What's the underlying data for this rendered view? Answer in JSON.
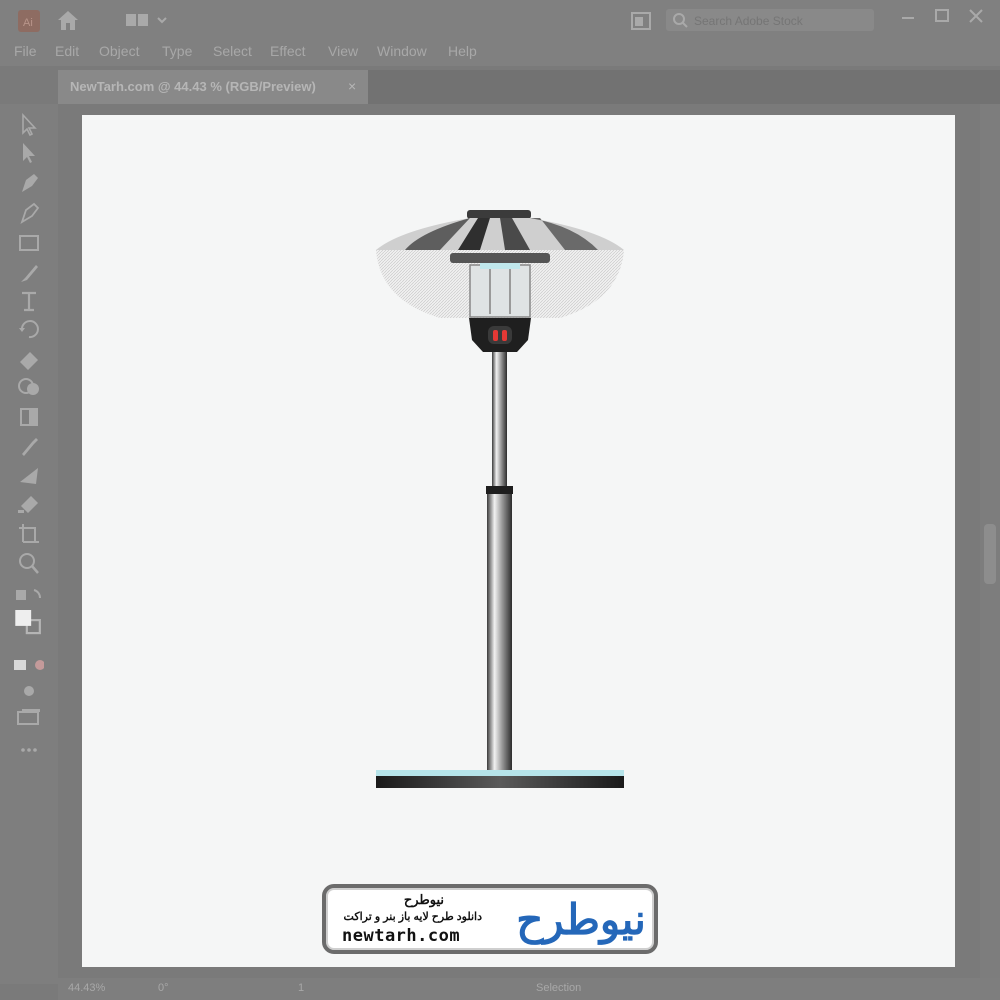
{
  "menu": [
    "File",
    "Edit",
    "Object",
    "Type",
    "Select",
    "Effect",
    "View",
    "Window",
    "Help"
  ],
  "search": {
    "placeholder": "Search Adobe Stock"
  },
  "document_tab": {
    "title": "NewTarh.com @ 44.43 % (RGB/Preview)",
    "close": "×"
  },
  "status": {
    "zoom": "44.43%",
    "rotation": "0°",
    "artboard": "1",
    "tool": "Selection"
  },
  "watermark": {
    "title_fa": "نیوطرح",
    "subtitle_fa": "دانلود طرح لایه باز بنر و تراکت",
    "url": "newtarh.com",
    "logo_fa": "نیوطرح"
  },
  "colors": {
    "chrome": "#808080",
    "artboard": "#f5f6f6",
    "accent": "#2467b9",
    "lamp_light": "#e53935"
  },
  "icons": [
    "ai-logo-icon",
    "home-icon",
    "workspace-switcher-icon",
    "arrange-documents-icon",
    "search-icon",
    "minimize-icon",
    "maximize-icon",
    "close-icon",
    "selection-tool-icon",
    "direct-selection-tool-icon",
    "pen-tool-icon",
    "curvature-tool-icon",
    "rectangle-tool-icon",
    "paintbrush-tool-icon",
    "type-tool-icon",
    "rotate-tool-icon",
    "eraser-tool-icon",
    "shape-builder-tool-icon",
    "gradient-tool-icon",
    "eyedropper-tool-icon",
    "blend-tool-icon",
    "symbol-sprayer-tool-icon",
    "artboard-tool-icon",
    "zoom-tool-icon",
    "swap-colors-icon",
    "fill-stroke-icon",
    "color-mode-icon",
    "draw-mode-icon",
    "screen-mode-icon",
    "more-tools-icon"
  ]
}
